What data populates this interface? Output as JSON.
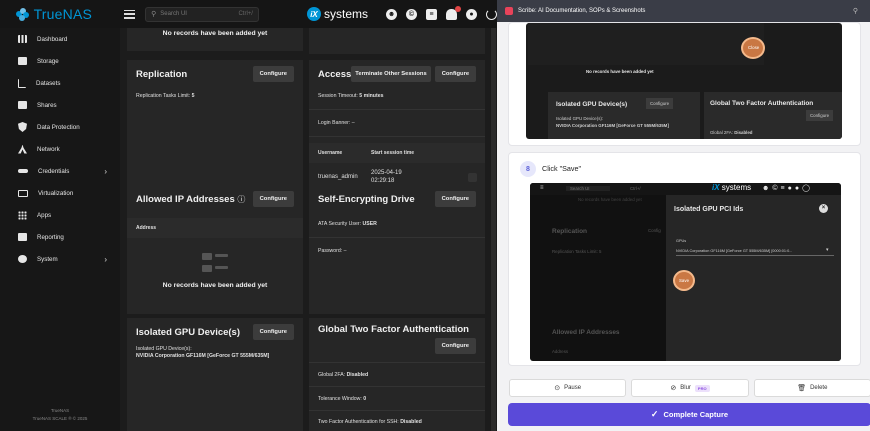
{
  "truenas": {
    "logo_text": "TrueNAS",
    "logo_sub": "SCALE",
    "search_placeholder": "Search UI",
    "search_shortcut": "Ctrl+/",
    "brand_text": "systems",
    "brand_mark": "iX",
    "sidebar": {
      "items": [
        {
          "label": "Dashboard"
        },
        {
          "label": "Storage"
        },
        {
          "label": "Datasets"
        },
        {
          "label": "Shares"
        },
        {
          "label": "Data Protection"
        },
        {
          "label": "Network"
        },
        {
          "label": "Credentials",
          "chevron": "›"
        },
        {
          "label": "Virtualization"
        },
        {
          "label": "Apps"
        },
        {
          "label": "Reporting"
        },
        {
          "label": "System",
          "chevron": "›"
        }
      ],
      "footer_line1": "TrueNAS",
      "footer_line2": "TrueNAS SCALE ® © 2025"
    },
    "cards": {
      "top_left_empty": "No records have been added yet",
      "replication": {
        "title": "Replication",
        "button": "Configure",
        "limit_label": "Replication Tasks Limit:",
        "limit_value": "5"
      },
      "access": {
        "title": "Access",
        "terminate_button": "Terminate Other Sessions",
        "configure_button": "Configure",
        "timeout_label": "Session Timeout:",
        "timeout_value": "5 minutes",
        "banner_label": "Login Banner:",
        "banner_value": "–",
        "col_username": "Username",
        "col_start": "Start session time",
        "row_user": "truenas_admin",
        "row_date": "2025-04-19",
        "row_time": "02:29:18"
      },
      "allowed_ip": {
        "title": "Allowed IP Addresses",
        "button": "Configure",
        "col_address": "Address",
        "empty": "No records have been added yet"
      },
      "sed": {
        "title": "Self-Encrypting Drive",
        "button": "Configure",
        "ata_label": "ATA Security User:",
        "ata_value": "USER",
        "password_label": "Password:",
        "password_value": "–"
      },
      "isolated_gpu": {
        "title": "Isolated GPU Device(s)",
        "button": "Configure",
        "devices_label": "Isolated GPU Device(s):",
        "device_value": "NVIDIA Corporation GF116M [GeForce GT 555M/635M]"
      },
      "two_factor": {
        "title": "Global Two Factor Authentication",
        "button": "Configure",
        "global_label": "Global 2FA:",
        "global_value": "Disabled",
        "tolerance_label": "Tolerance Window:",
        "tolerance_value": "0",
        "ssh_label": "Two Factor Authentication for SSH:",
        "ssh_value": "Disabled"
      }
    }
  },
  "scribe": {
    "window_title": "Scribe: AI Documentation, SOPs & Screenshots",
    "pin_icon": "pin-icon",
    "step7_shot": {
      "close_label": "Close",
      "empty": "No records have been added yet",
      "gpu_title": "Isolated GPU Device(s)",
      "gpu_button": "Configure",
      "gpu_line1": "Isolated GPU Device(s):",
      "gpu_line2": "NVIDIA Corporation GF116M [GeForce GT 555M/635M]",
      "tfa_title": "Global Two Factor Authentication",
      "tfa_button": "Configure",
      "tfa_line": "Global 2FA:",
      "tfa_value": "Disabled"
    },
    "step8": {
      "number": "8",
      "text": "Click \"Save\"",
      "shot": {
        "search": "Search UI",
        "shortcut": "Ctrl+/",
        "brand": "systems",
        "empty": "No records have been added yet",
        "replication": "Replication",
        "replication_limit": "Replication Tasks Limit: 5",
        "allowed_ip": "Allowed IP Addresses",
        "address": "Address",
        "dialog_title": "Isolated GPU PCI Ids",
        "gpus_label": "GPUs",
        "gpus_value": "NVIDIA Corporation GF116M [GeForce GT 555M/635M] [0000:01:0...",
        "save_label": "Save",
        "config_btn": "Config"
      }
    },
    "actions": {
      "pause": "Pause",
      "blur": "Blur",
      "blur_badge": "PRO",
      "delete": "Delete",
      "complete": "Complete Capture"
    },
    "colors": {
      "accent": "#5a4ad9",
      "highlight": "#e8874a",
      "truenas_blue": "#0095d5"
    }
  }
}
